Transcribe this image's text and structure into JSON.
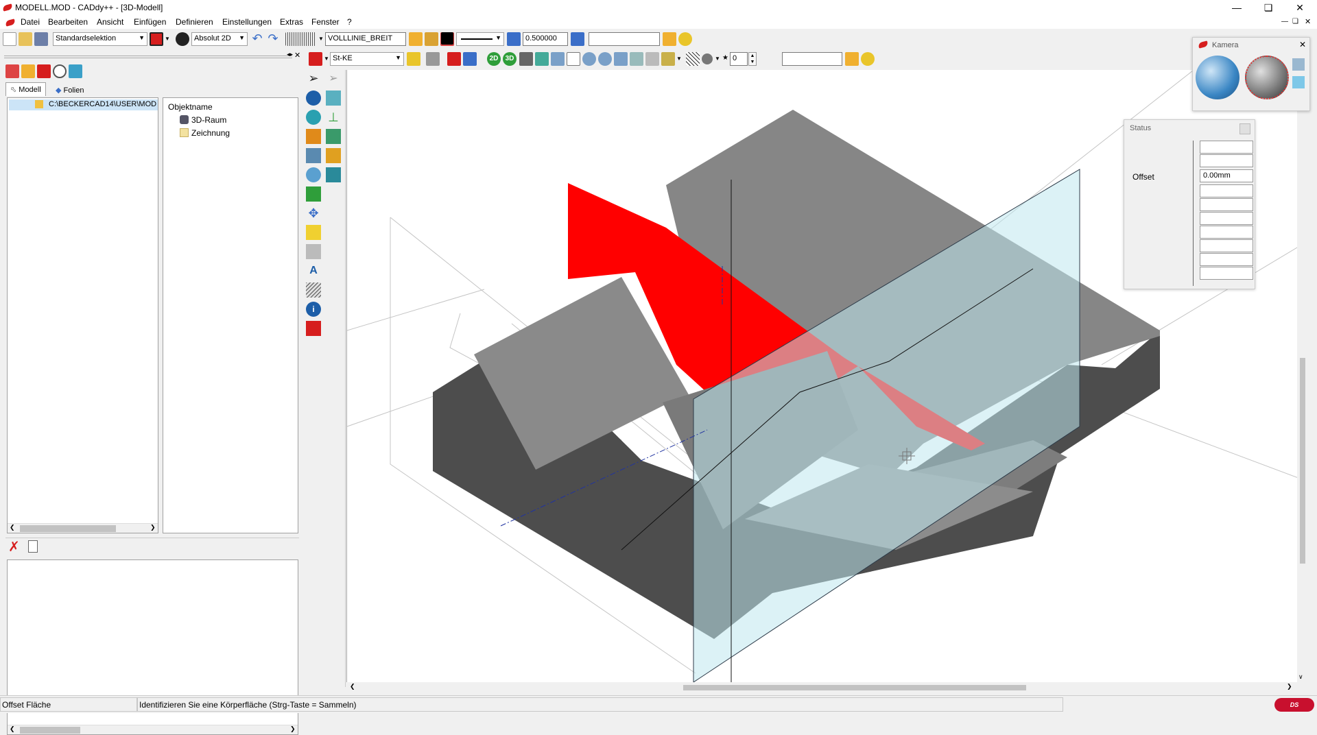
{
  "window": {
    "title": "MODELL.MOD  -  CADdy++ - [3D-Modell]",
    "controls": [
      "minimize",
      "restore",
      "close"
    ]
  },
  "menu": [
    "Datei",
    "Bearbeiten",
    "Ansicht",
    "Einfügen",
    "Definieren",
    "Einstellungen",
    "Extras",
    "Fenster",
    "?"
  ],
  "toolbar1": {
    "selection_mode": "Standardselektion",
    "coord_mode": "Absolut 2D",
    "linetype": "VOLLLINIE_BREIT",
    "linewidth": "0.500000",
    "search_value": ""
  },
  "toolbar2": {
    "material": "St-KE",
    "count_value": "0",
    "field_value": ""
  },
  "left_panel": {
    "tabs": [
      "Modell",
      "Folien"
    ],
    "tree_root": "C:\\BECKERCAD14\\USER\\MOD",
    "objects_header": "Objektname",
    "objects": [
      "3D-Raum",
      "Zeichnung"
    ]
  },
  "kamera_panel": {
    "title": "Kamera"
  },
  "status_panel": {
    "title": "Status",
    "offset_label": "Offset",
    "offset_value": "0.00mm"
  },
  "statusbar": {
    "mode": "Offset Fläche",
    "prompt": "Identifizieren Sie eine Körperfläche (Strg-Taste = Sammeln)"
  },
  "colors": {
    "highlight_face": "#ff0000",
    "top_face": "#858585",
    "side_face_dark": "#4d4d4d",
    "plane_fill": "#bfe8ee",
    "canvas_bg": "#ffffff"
  }
}
